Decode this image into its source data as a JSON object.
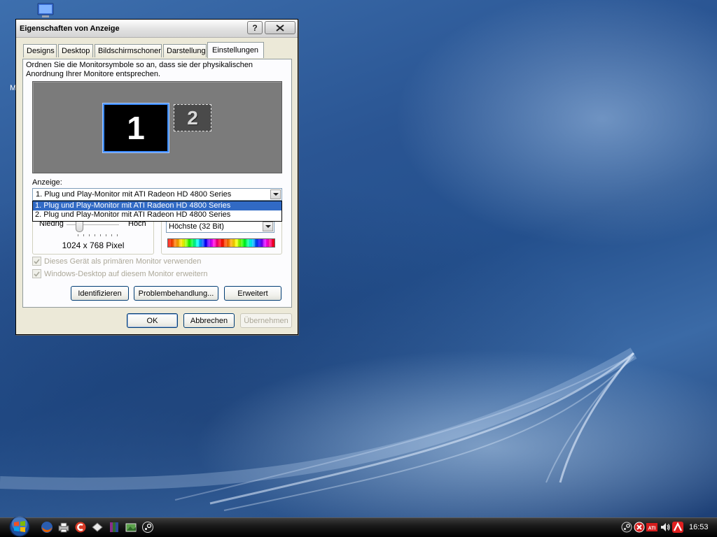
{
  "window": {
    "title": "Eigenschaften von Anzeige",
    "help_label": "?"
  },
  "tabs": [
    {
      "label": "Designs"
    },
    {
      "label": "Desktop"
    },
    {
      "label": "Bildschirmschoner"
    },
    {
      "label": "Darstellung"
    },
    {
      "label": "Einstellungen",
      "active": true
    }
  ],
  "settings": {
    "instruction": "Ordnen Sie die Monitorsymbole so an, dass sie der physikalischen Anordnung Ihrer Monitore entsprechen.",
    "monitors": [
      {
        "number": "1",
        "selected": true
      },
      {
        "number": "2",
        "selected": false
      }
    ],
    "display_label": "Anzeige:",
    "display_value": "1. Plug und Play-Monitor mit ATI Radeon HD 4800 Series",
    "display_options": [
      "1. Plug und Play-Monitor mit ATI Radeon HD 4800 Series",
      "2. Plug und Play-Monitor mit ATI Radeon HD 4800 Series"
    ],
    "resolution": {
      "low_label": "Niedrig",
      "high_label": "Hoch",
      "value": "1024 x 768 Pixel"
    },
    "color_quality": {
      "value": "Höchste (32 Bit)"
    },
    "checkboxes": [
      {
        "label": "Dieses Gerät als primären Monitor verwenden",
        "checked": true,
        "enabled": false
      },
      {
        "label": "Windows-Desktop auf diesem Monitor erweitern",
        "checked": true,
        "enabled": false
      }
    ],
    "buttons": {
      "identify": "Identifizieren",
      "troubleshoot": "Problembehandlung...",
      "advanced": "Erweitert"
    }
  },
  "footer_buttons": {
    "ok": "OK",
    "cancel": "Abbrechen",
    "apply": "Übernehmen"
  },
  "desktop": {
    "partial_label": "M"
  },
  "taskbar": {
    "clock": "16:53",
    "quick_launch": [
      "firefox-icon",
      "printer-icon",
      "ccleaner-icon",
      "diamond-icon",
      "winrar-icon",
      "photo-icon",
      "steam-icon"
    ],
    "tray": [
      "steam-icon",
      "security-icon",
      "ati-icon",
      "volume-icon",
      "antivir-icon"
    ]
  },
  "colors": {
    "window_bg": "#ece9d8",
    "panel_bg": "#fcfcfe",
    "selection": "#316ac5",
    "monitor_selected_border": "#3b8bff",
    "taskbar": "#000000"
  }
}
